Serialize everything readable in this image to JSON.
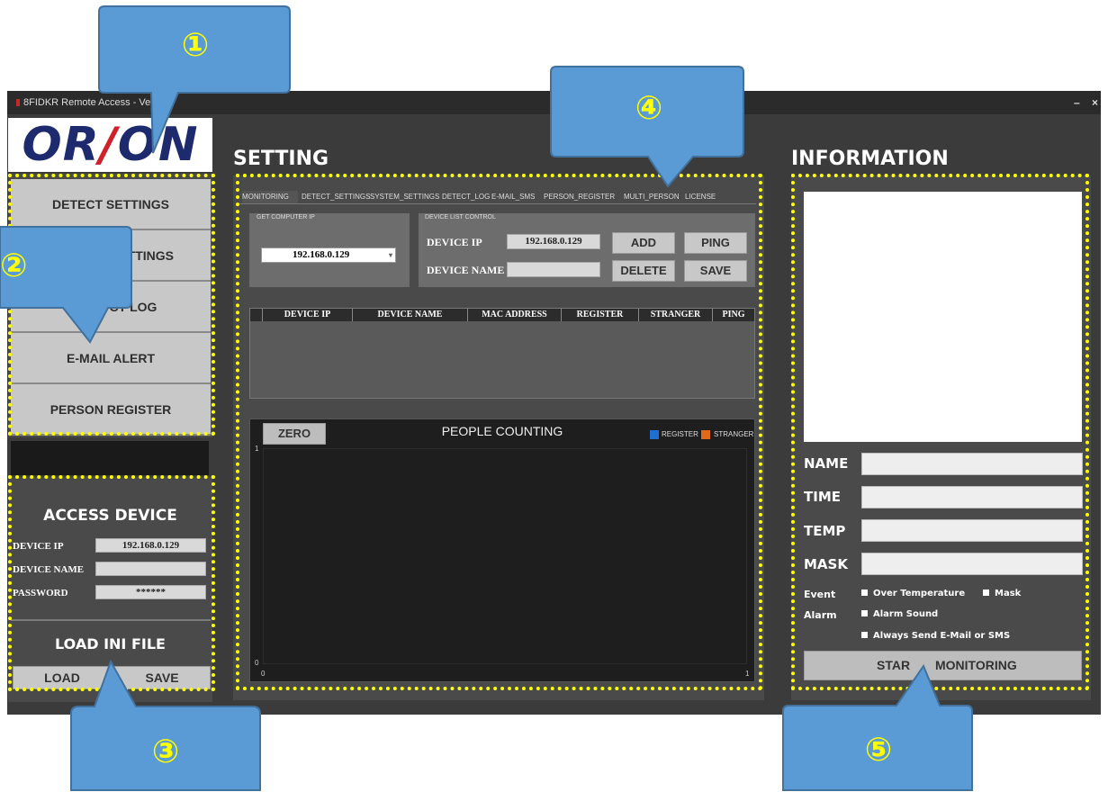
{
  "window": {
    "title": "8FIDKR Remote Access - Ver",
    "minimize": "–",
    "close": "×"
  },
  "logo": {
    "left": "OR",
    "slash": "/",
    "right": "ON"
  },
  "sidebar": {
    "menu": [
      {
        "label": "DETECT SETTINGS"
      },
      {
        "label": "SETTINGS"
      },
      {
        "label": "CT LOG"
      },
      {
        "label": "E-MAIL ALERT"
      },
      {
        "label": "PERSON REGISTER"
      }
    ],
    "access": {
      "title": "ACCESS DEVICE",
      "ip_label": "DEVICE IP",
      "ip_value": "192.168.0.129",
      "name_label": "DEVICE NAME",
      "name_value": "",
      "pw_label": "PASSWORD",
      "pw_value": "******"
    },
    "ini": {
      "title": "LOAD INI FILE",
      "load": "LOAD",
      "save": "SAVE"
    }
  },
  "setting": {
    "title": "SETTING",
    "tabs": [
      "MONITORING",
      "DETECT_SETTINGS",
      "SYSTEM_SETTINGS",
      "DETECT_LOG",
      "E-MAIL_SMS",
      "PERSON_REGISTER",
      "MULTI_PERSON",
      "LICENSE"
    ],
    "get_ip": {
      "title": "GET COMPUTER IP",
      "value": "192.168.0.129",
      "arrow": "▾"
    },
    "device_ctrl": {
      "title": "DEVICE LIST CONTROL",
      "ip_label": "DEVICE IP",
      "ip_value": "192.168.0.129",
      "name_label": "DEVICE NAME",
      "name_value": "",
      "add": "ADD",
      "ping": "PING",
      "delete": "DELETE",
      "save": "SAVE"
    },
    "table": {
      "headers": [
        "DEVICE IP",
        "DEVICE NAME",
        "MAC ADDRESS",
        "REGISTER",
        "STRANGER",
        "PING"
      ],
      "rows": []
    },
    "chart": {
      "zero": "ZERO",
      "title": "PEOPLE COUNTING",
      "legend": [
        {
          "name": "REGISTER",
          "color": "#1f6fd0"
        },
        {
          "name": "STRANGER",
          "color": "#e06a18"
        }
      ],
      "y_top": "1",
      "y_bottom": "0",
      "x_left": "0",
      "x_right": "1"
    }
  },
  "chart_data": {
    "type": "bar",
    "title": "PEOPLE COUNTING",
    "categories": [],
    "series": [
      {
        "name": "REGISTER",
        "values": []
      },
      {
        "name": "STRANGER",
        "values": []
      }
    ],
    "xlim": [
      0,
      1
    ],
    "ylim": [
      0,
      1
    ],
    "legend": "top-right"
  },
  "information": {
    "title": "INFORMATION",
    "fields": [
      {
        "label": "NAME",
        "value": ""
      },
      {
        "label": "TIME",
        "value": ""
      },
      {
        "label": "TEMP",
        "value": ""
      },
      {
        "label": "MASK",
        "value": ""
      }
    ],
    "event_label": "Event",
    "alarm_label": "Alarm",
    "over_temp": "Over Temperature",
    "mask": "Mask",
    "alarm_sound": "Alarm Sound",
    "always_send": "Always Send E-Mail or SMS",
    "start_left": "STAR",
    "start_right": "MONITORING"
  },
  "callouts": [
    "①",
    "②",
    "③",
    "④",
    "⑤"
  ],
  "colors": {
    "callout": "#5b9bd5",
    "highlight": "#ffff00",
    "panel": "#4a4a4a"
  }
}
